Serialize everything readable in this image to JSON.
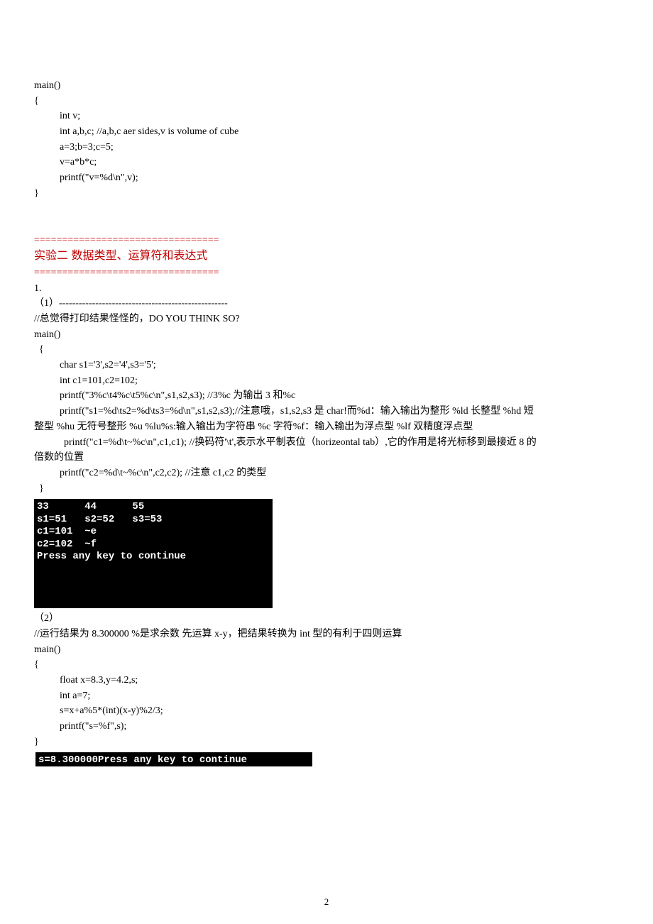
{
  "code1": {
    "l1": "main()",
    "l2": "{",
    "l3": "int v;",
    "l4": "int a,b,c; //a,b,c aer sides,v is volume of cube",
    "l5": "a=3;b=3;c=5;",
    "l6": "v=a*b*c;",
    "l7": "printf(\"v=%d\\n\",v);",
    "l8": "}"
  },
  "sep": "=================================",
  "heading": "实验二 数据类型、运算符和表达式",
  "sec1": {
    "num": "1.",
    "p1lead": "（1）",
    "p1dashes": "---------------------------------------------------",
    "comment": "//总觉得打印结果怪怪的，DO YOU THINK SO?",
    "c1": "main()",
    "c2": "  {",
    "c3": "char s1='3',s2='4',s3='5';",
    "c4": "int c1=101,c2=102;",
    "c5": "printf(\"3%c\\t4%c\\t5%c\\n\",s1,s2,s3); //3%c 为输出 3 和%c",
    "c6a": "printf(\"s1=%d\\ts2=%d\\ts3=%d\\n\",s1,s2,s3);//注意哦，s1,s2,s3 是 char!而%d：输入输出为整形  %ld 长整型  %hd 短",
    "c6b": "整型  %hu 无符号整形  %u %lu%s:输入输出为字符串  %c 字符%f：输入输出为浮点型  %lf 双精度浮点型",
    "c7a": "printf(\"c1=%d\\t~%c\\n\",c1,c1); //换码符'\\t',表示水平制表位（horizeontal tab）,它的作用是将光标移到最接近 8 的",
    "c7b": "倍数的位置",
    "c8": "printf(\"c2=%d\\t~%c\\n\",c2,c2); //注意 c1,c2 的类型",
    "c9": "  }"
  },
  "console1": "33      44      55\ns1=51   s2=52   s3=53\nc1=101  ~e\nc2=102  ~f\nPress any key to continue",
  "sec2": {
    "p2lead": "（2）",
    "comment": "//运行结果为 8.300000 %是求余数  先运算 x-y，把结果转换为 int 型的有利于四则运算",
    "c1": "main()",
    "c2": "{",
    "c3": "float x=8.3,y=4.2,s;",
    "c4": "int a=7;",
    "c5": "s=x+a%5*(int)(x-y)%2/3;",
    "c6": "printf(\"s=%f\",s);",
    "c7": "}"
  },
  "console2": "s=8.300000Press any key to continue",
  "pageNumber": "2"
}
